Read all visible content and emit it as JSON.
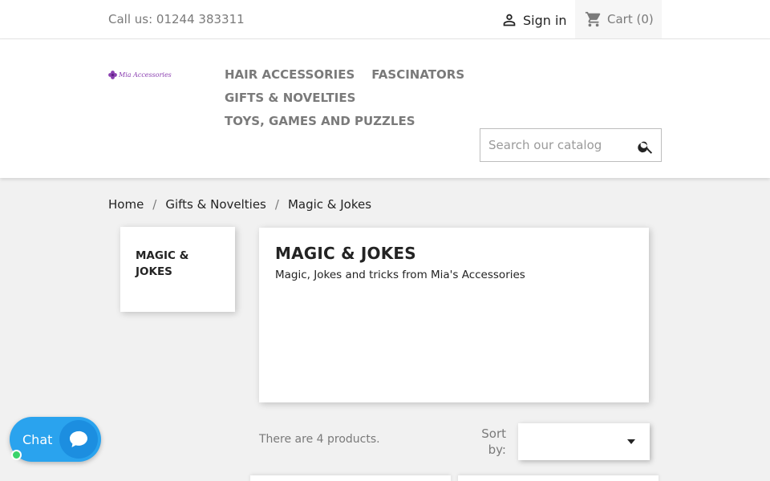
{
  "topbar": {
    "contact": "Call us: 01244 383311",
    "sign_in": "Sign in",
    "cart_label": "Cart",
    "cart_count": "(0)"
  },
  "header": {
    "logo_text": "Mia Accessories",
    "menu": [
      "HAIR ACCESSORIES",
      "FASCINATORS",
      "GIFTS & NOVELTIES",
      "TOYS, GAMES AND PUZZLES"
    ],
    "search_placeholder": "Search our catalog"
  },
  "breadcrumb": [
    "Home",
    "Gifts & Novelties",
    "Magic & Jokes"
  ],
  "sidebar": {
    "lines": [
      "MAGIC &",
      "JOKES"
    ]
  },
  "category": {
    "title": "MAGIC & JOKES",
    "description": "Magic, Jokes and tricks from Mia's Accessories"
  },
  "products": {
    "count_text": "There are 4 products.",
    "sort_label_1": "Sort",
    "sort_label_2": "by:",
    "sort_value": ""
  },
  "chat": {
    "label": "Chat"
  },
  "colors": {
    "accent": "#2aa3ee",
    "online": "#3ad36a",
    "logo": "#8a3fb0"
  },
  "icons": {
    "user": "person-outline-icon",
    "cart": "shopping-cart-icon",
    "search": "search-icon",
    "chat": "chat-bubble-icon"
  }
}
